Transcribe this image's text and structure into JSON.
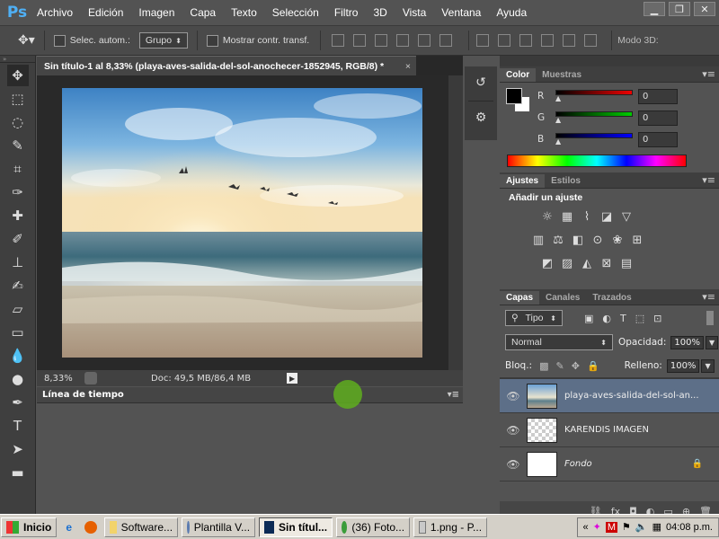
{
  "app": {
    "logo": "Ps"
  },
  "menu": [
    "Archivo",
    "Edición",
    "Imagen",
    "Capa",
    "Texto",
    "Selección",
    "Filtro",
    "3D",
    "Vista",
    "Ventana",
    "Ayuda"
  ],
  "window_controls": [
    "minimize-icon",
    "restore-icon",
    "close-icon"
  ],
  "options_bar": {
    "auto_select_label": "Selec. autom.:",
    "auto_select_value": "Grupo",
    "show_transform_label": "Mostrar contr. transf.",
    "mode_3d_label": "Modo 3D:"
  },
  "tools": [
    "move-tool",
    "marquee-tool",
    "lasso-tool",
    "quick-select-tool",
    "crop-tool",
    "eyedropper-tool",
    "healing-tool",
    "brush-tool",
    "stamp-tool",
    "history-brush-tool",
    "eraser-tool",
    "gradient-tool",
    "blur-tool",
    "dodge-tool",
    "pen-tool",
    "type-tool",
    "path-select-tool",
    "shape-tool"
  ],
  "document": {
    "tab_title": "Sin título-1 al 8,33% (playa-aves-salida-del-sol-anochecer-1852945, RGB/8) *",
    "close": "×",
    "zoom": "8,33%",
    "doc_size": "Doc: 49,5 MB/86,4 MB"
  },
  "timeline": {
    "title": "Línea de tiempo"
  },
  "color_panel": {
    "tabs": [
      "Color",
      "Muestras"
    ],
    "channels": [
      {
        "label": "R",
        "value": "0"
      },
      {
        "label": "G",
        "value": "0"
      },
      {
        "label": "B",
        "value": "0"
      }
    ]
  },
  "adjustments_panel": {
    "tabs": [
      "Ajustes",
      "Estilos"
    ],
    "heading": "Añadir un ajuste"
  },
  "layers_panel": {
    "tabs": [
      "Capas",
      "Canales",
      "Trazados"
    ],
    "filter_label": "Tipo",
    "blend_mode": "Normal",
    "opacity_label": "Opacidad:",
    "opacity_value": "100%",
    "lock_label": "Bloq.:",
    "fill_label": "Relleno:",
    "fill_value": "100%",
    "layers": [
      {
        "name": "playa-aves-salida-del-sol-an...",
        "selected": true
      },
      {
        "name": "KARENDIS IMAGEN",
        "selected": false
      },
      {
        "name": "Fondo",
        "selected": false
      }
    ]
  },
  "taskbar": {
    "start": "Inicio",
    "tasks": [
      "Software...",
      "Plantilla V...",
      "Sin títul...",
      "(36) Foto...",
      "1.png - P..."
    ],
    "clock": "04:08 p.m."
  },
  "colors": {
    "accent": "#4fb0f5",
    "panel": "#535353",
    "dark": "#282828"
  }
}
